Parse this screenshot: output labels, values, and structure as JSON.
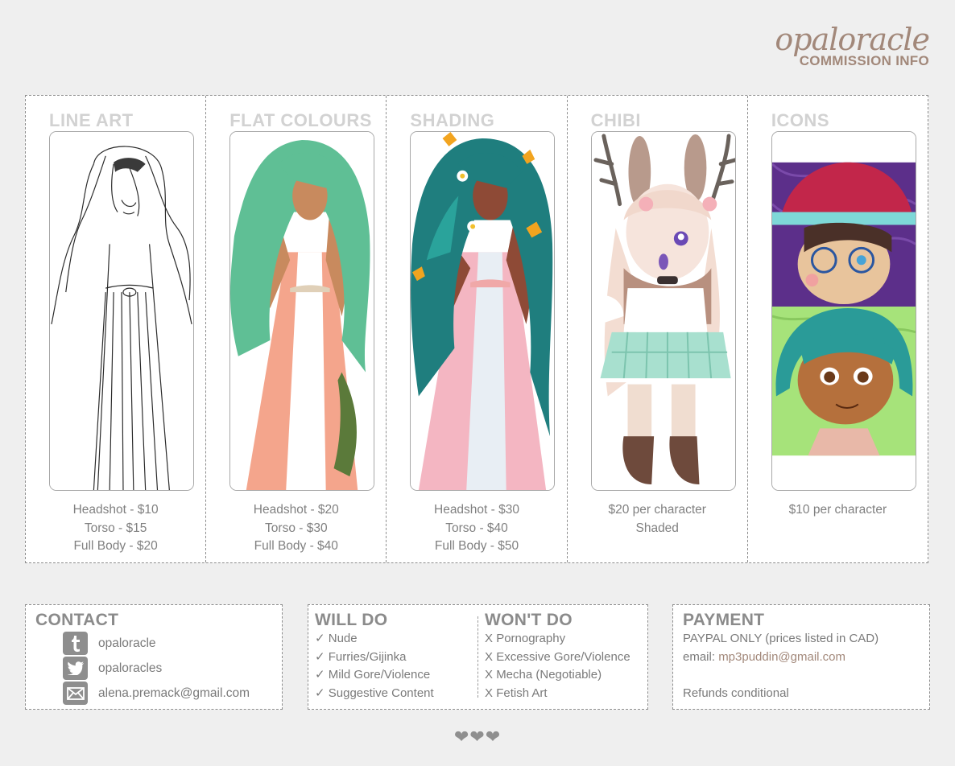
{
  "brand": {
    "name": "opaloracle",
    "subtitle": "COMMISSION INFO"
  },
  "tiers": [
    {
      "title": "LINE ART",
      "prices": [
        "Headshot - $10",
        "Torso - $15",
        "Full Body - $20"
      ]
    },
    {
      "title": "FLAT COLOURS",
      "prices": [
        "Headshot - $20",
        "Torso - $30",
        "Full Body - $40"
      ]
    },
    {
      "title": "SHADING",
      "prices": [
        "Headshot - $30",
        "Torso - $40",
        "Full Body - $50"
      ]
    },
    {
      "title": "CHIBI",
      "prices": [
        "$20 per character",
        "Shaded"
      ]
    },
    {
      "title": "ICONS",
      "prices": [
        "$10 per character"
      ]
    }
  ],
  "contact": {
    "title": "CONTACT",
    "items": [
      {
        "icon": "tumblr-icon",
        "text": "opaloracle"
      },
      {
        "icon": "twitter-icon",
        "text": "opaloracles"
      },
      {
        "icon": "email-icon",
        "text": "alena.premack@gmail.com"
      }
    ]
  },
  "will_do": {
    "title": "WILL DO",
    "marker": "✓",
    "items": [
      "Nude",
      "Furries/Gijinka",
      "Mild Gore/Violence",
      "Suggestive Content"
    ]
  },
  "wont_do": {
    "title": "WON'T DO",
    "marker": "X",
    "items": [
      "Pornography",
      "Excessive Gore/Violence",
      "Mecha (Negotiable)",
      "Fetish Art"
    ]
  },
  "payment": {
    "title": "PAYMENT",
    "line1": "PAYPAL ONLY (prices listed in CAD)",
    "email_label": "email:",
    "email": "mp3puddin@gmail.com",
    "refunds": "Refunds conditional"
  },
  "footer": {
    "hearts": "❤❤❤"
  },
  "colors": {
    "accent": "#a2887a",
    "background": "#efefef",
    "text": "#7a7a7a",
    "tier_title": "#d2d2d2",
    "hair_green": "#5fbf95",
    "skin": "#c88a5e",
    "dress_peach": "#f4a58c",
    "dress_pink": "#f4b6c2",
    "teal_hair": "#1f7e7e",
    "icon_hat": "#c2264a",
    "icon_bg_purple": "#5c2f8a"
  }
}
